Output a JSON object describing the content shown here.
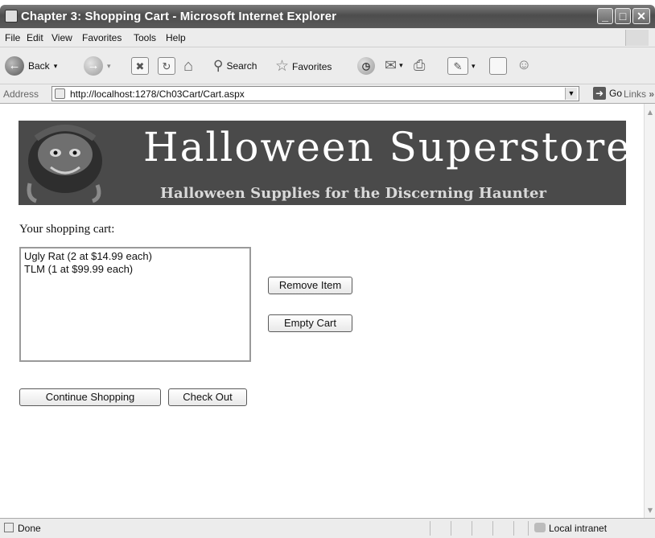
{
  "window": {
    "title": "Chapter 3: Shopping Cart - Microsoft Internet Explorer"
  },
  "menu": [
    "File",
    "Edit",
    "View",
    "Favorites",
    "Tools",
    "Help"
  ],
  "toolbar": {
    "back_label": "Back",
    "search_label": "Search",
    "favorites_label": "Favorites"
  },
  "address": {
    "label": "Address",
    "url": "http://localhost:1278/Ch03Cart/Cart.aspx",
    "go_label": "Go",
    "links_label": "Links"
  },
  "banner": {
    "title": "Halloween Superstore",
    "subtitle": "Halloween Supplies for the Discerning Haunter"
  },
  "cart": {
    "label": "Your shopping cart:",
    "items": [
      "Ugly Rat (2 at $14.99 each)",
      "TLM (1 at $99.99 each)"
    ],
    "remove_label": "Remove Item",
    "empty_label": "Empty Cart",
    "continue_label": "Continue Shopping",
    "checkout_label": "Check Out"
  },
  "status": {
    "text": "Done",
    "zone": "Local intranet"
  },
  "icons": {
    "back": "back-arrow-icon",
    "forward": "forward-arrow-icon",
    "stop": "stop-icon",
    "refresh": "refresh-icon",
    "home": "home-icon",
    "search": "search-icon",
    "favorites": "favorites-star-icon",
    "history": "history-icon",
    "mail": "mail-icon",
    "print": "print-icon",
    "edit": "edit-icon",
    "discuss": "discuss-icon",
    "messenger": "messenger-icon"
  }
}
